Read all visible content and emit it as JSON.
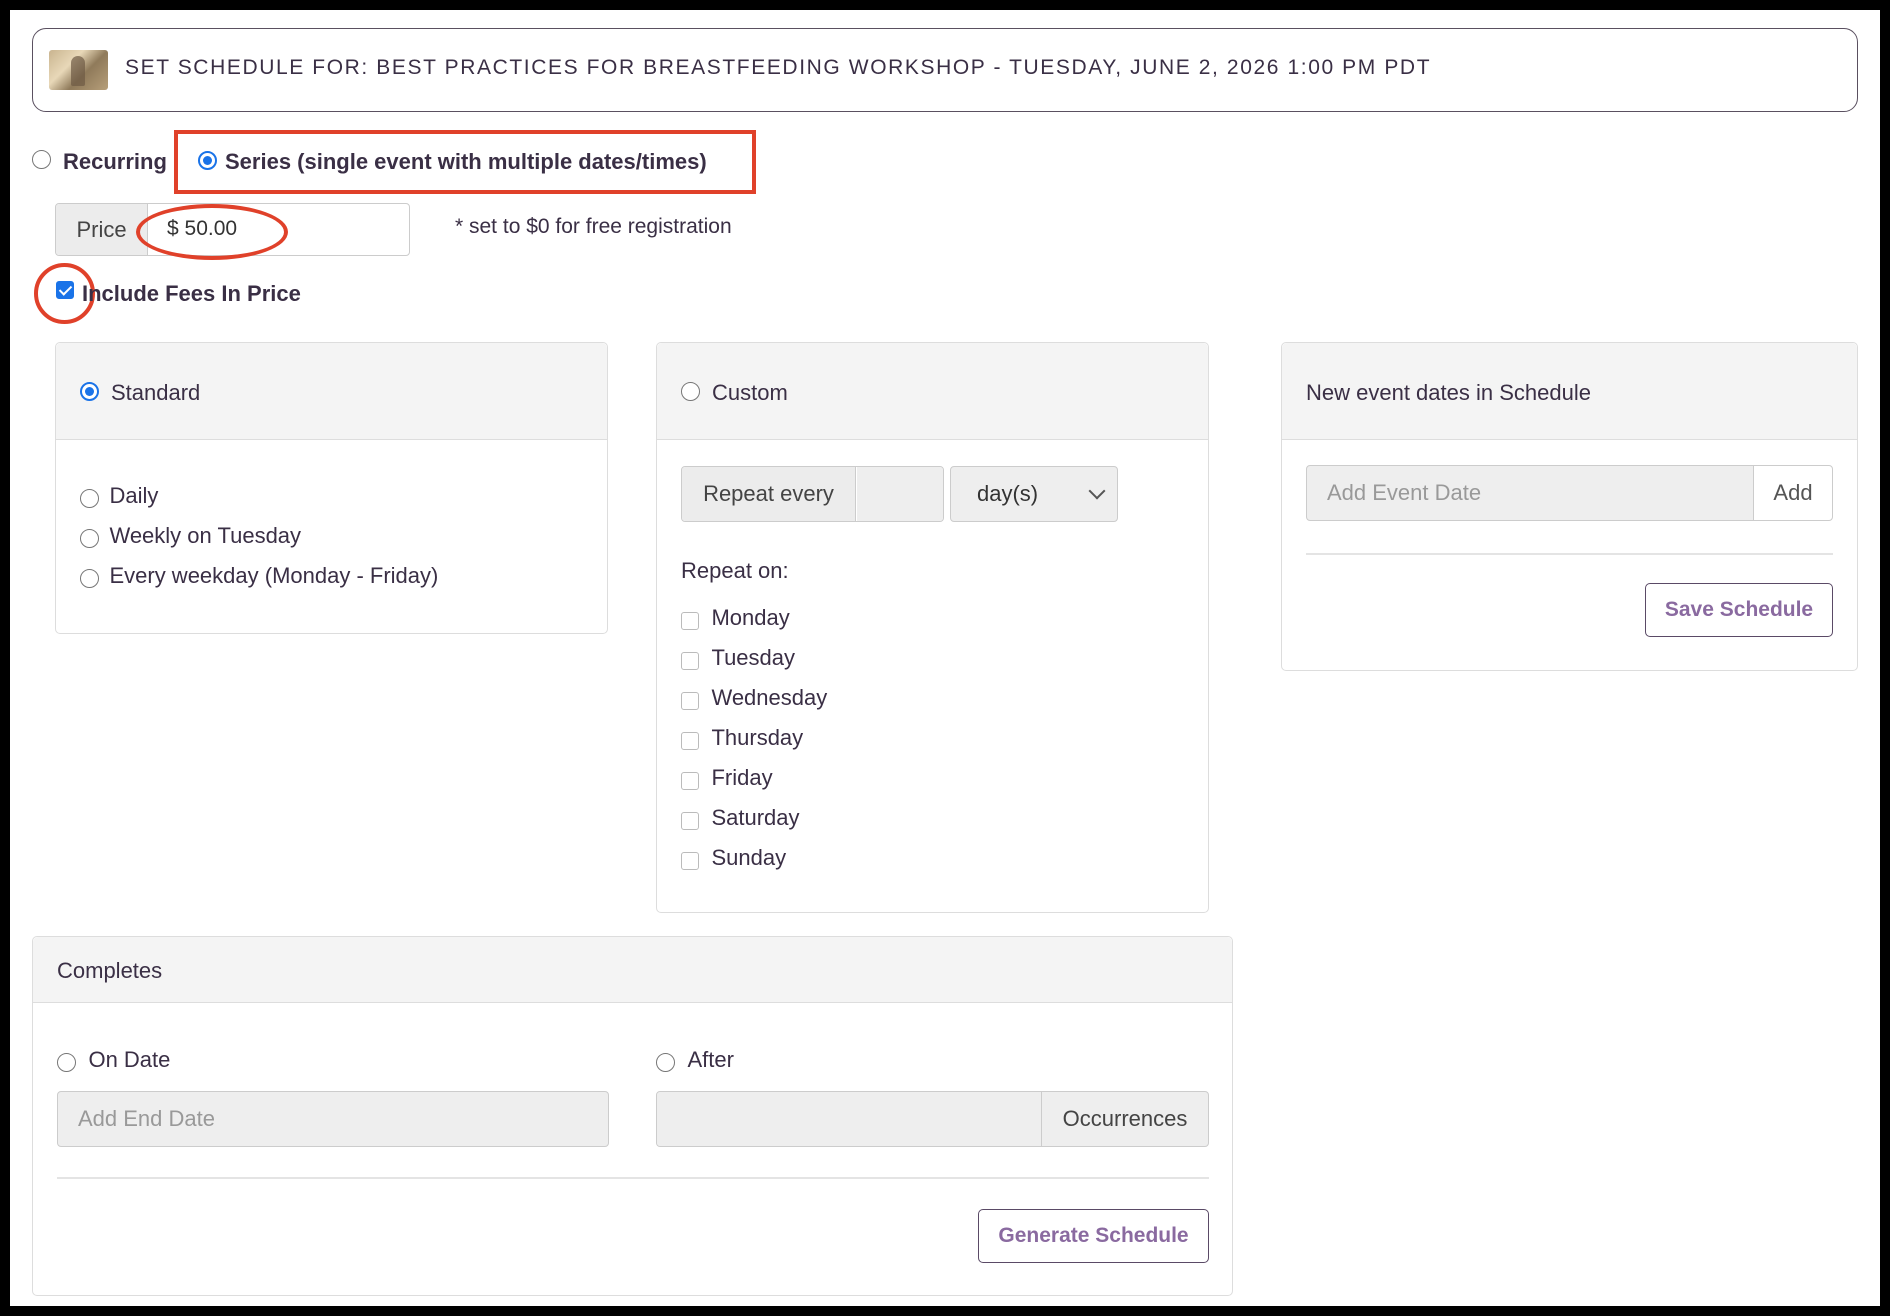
{
  "header": {
    "title": "SET SCHEDULE FOR: BEST PRACTICES FOR BREASTFEEDING WORKSHOP - TUESDAY, JUNE 2, 2026 1:00 PM PDT"
  },
  "mode": {
    "recurring_label": "Recurring",
    "series_label": "Series (single event with multiple dates/times)",
    "selected": "series"
  },
  "price": {
    "addon_label": "Price",
    "value": "$ 50.00",
    "note": "* set to $0 for free registration"
  },
  "include_fees": {
    "label": "Include Fees In Price",
    "checked": true
  },
  "standard": {
    "title": "Standard",
    "options": [
      "Daily",
      "Weekly on Tuesday",
      "Every weekday (Monday - Friday)"
    ]
  },
  "custom": {
    "title": "Custom",
    "repeat_every_label": "Repeat every",
    "repeat_every_value": "",
    "unit_selected": "day(s)",
    "repeat_on_label": "Repeat on:",
    "days": [
      "Monday",
      "Tuesday",
      "Wednesday",
      "Thursday",
      "Friday",
      "Saturday",
      "Sunday"
    ]
  },
  "new_dates": {
    "title": "New event dates in Schedule",
    "add_placeholder": "Add Event Date",
    "add_button": "Add",
    "save_button": "Save Schedule"
  },
  "completes": {
    "title": "Completes",
    "on_date_label": "On Date",
    "end_date_placeholder": "Add End Date",
    "after_label": "After",
    "occurrences_label": "Occurrences",
    "generate_button": "Generate Schedule"
  },
  "colors": {
    "accent_blue": "#1a73e8",
    "annotation_red": "#e0412a",
    "button_text_purple": "#8a6aa0",
    "text_dark": "#3a2f45"
  }
}
